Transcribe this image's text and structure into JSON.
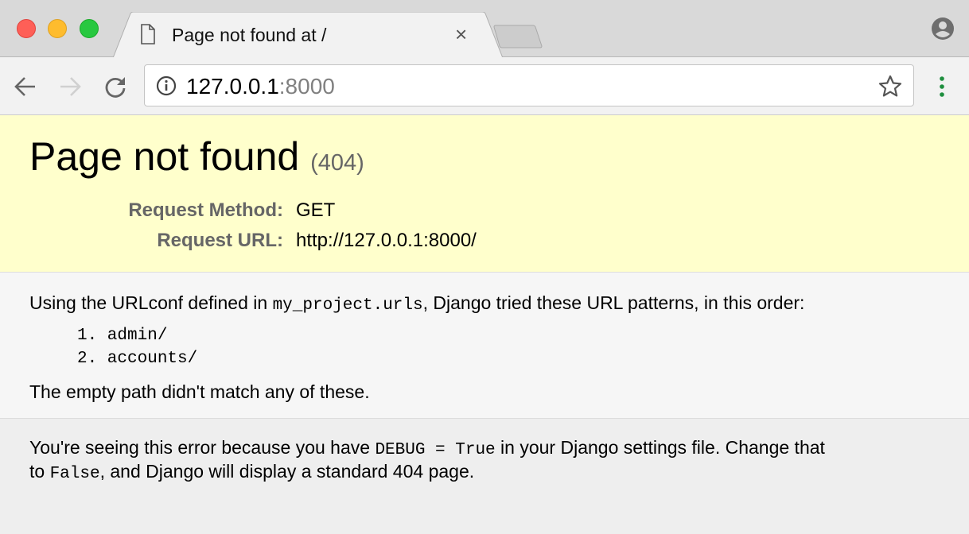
{
  "browser": {
    "tab_title": "Page not found at /",
    "close_icon": "×",
    "url_host": "127.0.0.1",
    "url_port": ":8000",
    "traffic_light_colors": [
      "#fe5f57",
      "#febc2e",
      "#28c840"
    ]
  },
  "page": {
    "title": "Page not found",
    "status_code": "(404)",
    "request": [
      {
        "label": "Request Method:",
        "value": "GET"
      },
      {
        "label": "Request URL:",
        "value": "http://127.0.0.1:8000/"
      }
    ],
    "info": {
      "prefix": "Using the URLconf defined in ",
      "urlconf": "my_project.urls",
      "suffix": ", Django tried these URL patterns, in this order:",
      "patterns": [
        "1. admin/",
        "2. accounts/"
      ],
      "no_match": "The empty path didn't match any of these."
    },
    "explanation": {
      "part1": "You're seeing this error because you have ",
      "code1": "DEBUG = True",
      "part2": " in your Django settings file. Change that",
      "part3": "to ",
      "code2": "False",
      "part4": ", and Django will display a standard 404 page."
    }
  },
  "colors": {
    "header_bg": "#ffffcc",
    "menu_icon": "#1e8e3e"
  }
}
